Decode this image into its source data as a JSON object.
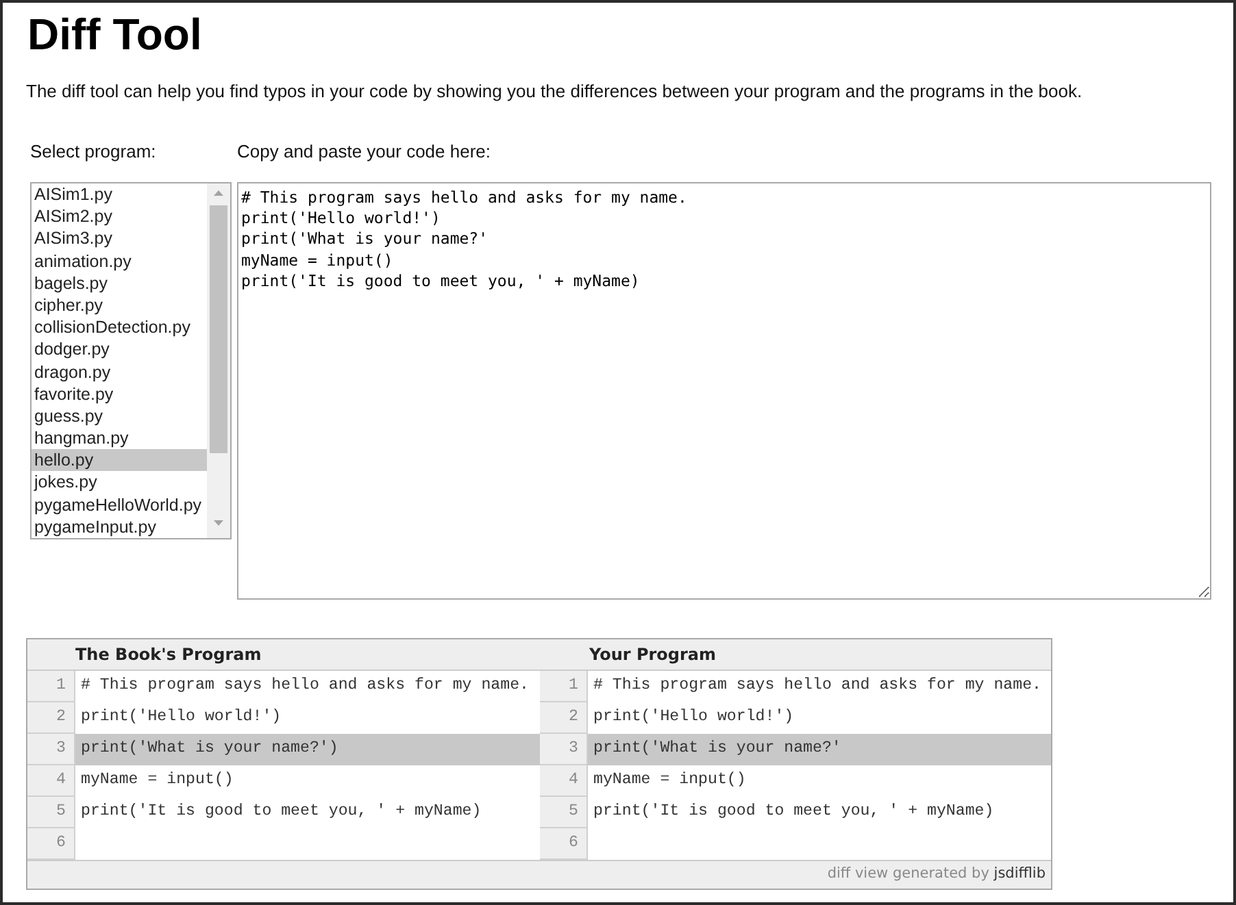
{
  "title": "Diff Tool",
  "description": "The diff tool can help you find typos in your code by showing you the differences between your program and the programs in the book.",
  "program_select": {
    "label": "Select program:",
    "items": [
      {
        "label": "AISim1.py",
        "selected": false
      },
      {
        "label": "AISim2.py",
        "selected": false
      },
      {
        "label": "AISim3.py",
        "selected": false
      },
      {
        "label": "animation.py",
        "selected": false
      },
      {
        "label": "bagels.py",
        "selected": false
      },
      {
        "label": "cipher.py",
        "selected": false
      },
      {
        "label": "collisionDetection.py",
        "selected": false
      },
      {
        "label": "dodger.py",
        "selected": false
      },
      {
        "label": "dragon.py",
        "selected": false
      },
      {
        "label": "favorite.py",
        "selected": false
      },
      {
        "label": "guess.py",
        "selected": false
      },
      {
        "label": "hangman.py",
        "selected": false
      },
      {
        "label": "hello.py",
        "selected": true
      },
      {
        "label": "jokes.py",
        "selected": false
      },
      {
        "label": "pygameHelloWorld.py",
        "selected": false
      },
      {
        "label": "pygameInput.py",
        "selected": false
      }
    ]
  },
  "code_input": {
    "label": "Copy and paste your code here:",
    "value": "# This program says hello and asks for my name.\nprint('Hello world!')\nprint('What is your name?'\nmyName = input()\nprint('It is good to meet you, ' + myName)"
  },
  "diff_view": {
    "columns": [
      "The Book's Program",
      "Your Program"
    ],
    "rows": [
      {
        "left_line": "1",
        "left_code": "# This program says hello and asks for my name.",
        "right_line": "1",
        "right_code": "# This program says hello and asks for my name.",
        "changed": false
      },
      {
        "left_line": "2",
        "left_code": "print('Hello world!')",
        "right_line": "2",
        "right_code": "print('Hello world!')",
        "changed": false
      },
      {
        "left_line": "3",
        "left_code": "print('What is your name?')",
        "right_line": "3",
        "right_code": "print('What is your name?'",
        "changed": true
      },
      {
        "left_line": "4",
        "left_code": "myName = input()",
        "right_line": "4",
        "right_code": "myName = input()",
        "changed": false
      },
      {
        "left_line": "5",
        "left_code": "print('It is good to meet you, ' + myName)",
        "right_line": "5",
        "right_code": "print('It is good to meet you, ' + myName)",
        "changed": false
      },
      {
        "left_line": "6",
        "right_line": "6",
        "changed": false
      }
    ],
    "footer": {
      "text": "diff view generated by",
      "link": "jsdifflib"
    }
  }
}
